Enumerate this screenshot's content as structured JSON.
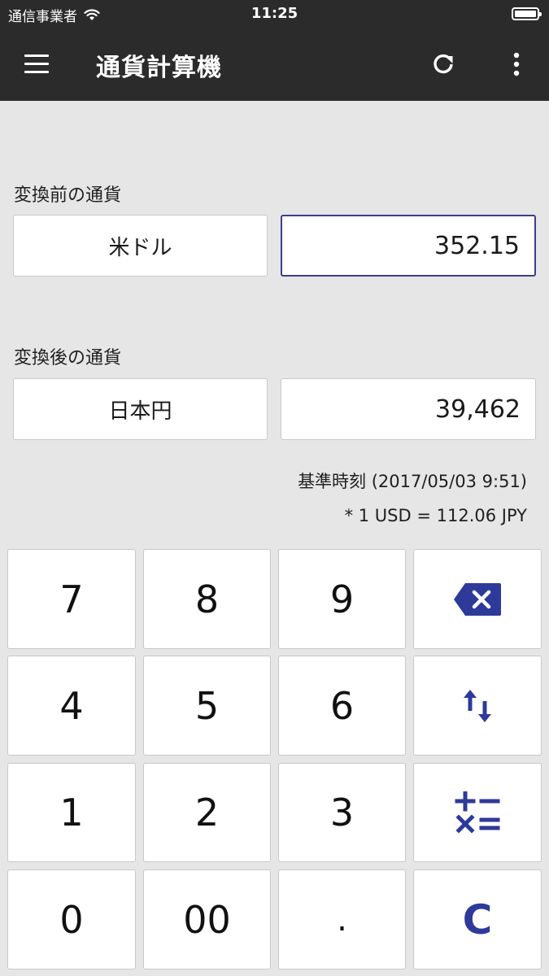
{
  "status_bar": {
    "carrier": "通信事業者",
    "time": "11:25",
    "wifi_icon": "wifi-icon",
    "battery_icon": "battery-icon"
  },
  "app_bar": {
    "title": "通貨計算機",
    "menu_icon": "hamburger-menu-icon",
    "refresh_icon": "refresh-icon",
    "more_icon": "more-vert-icon"
  },
  "source": {
    "label": "変換前の通貨",
    "currency": "米ドル",
    "amount": "352.15"
  },
  "target": {
    "label": "変換後の通貨",
    "currency": "日本円",
    "amount": "39,462"
  },
  "rate_info": {
    "timestamp": "基準時刻 (2017/05/03 9:51)",
    "rate": "* 1 USD = 112.06 JPY"
  },
  "keypad": {
    "k7": "7",
    "k8": "8",
    "k9": "9",
    "k4": "4",
    "k5": "5",
    "k6": "6",
    "k1": "1",
    "k2": "2",
    "k3": "3",
    "k0": "0",
    "k00": "00",
    "kdot": ".",
    "clear": "C",
    "backspace_icon": "backspace-icon",
    "swap_icon": "swap-vertical-icon",
    "operators_icon": "calculator-operators-icon"
  },
  "colors": {
    "app_bar": "#2b2b2b",
    "background": "#e6e6e6",
    "accent": "#2e3a9a",
    "active_border": "#3a3f8f"
  }
}
